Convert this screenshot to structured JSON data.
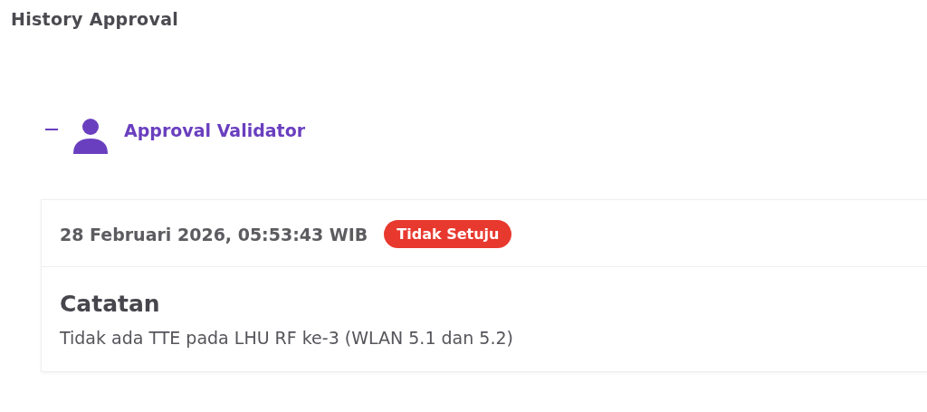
{
  "page_title": "History Approval",
  "approvals": [
    {
      "role": "Approval Validator",
      "expanded": true,
      "timestamp": "28 Februari 2026, 05:53:43 WIB",
      "status": {
        "label": "Tidak Setuju",
        "kind": "rejected"
      },
      "note_title": "Catatan",
      "note": "Tidak ada TTE pada LHU RF ke-3 (WLAN 5.1 dan 5.2)"
    }
  ]
}
